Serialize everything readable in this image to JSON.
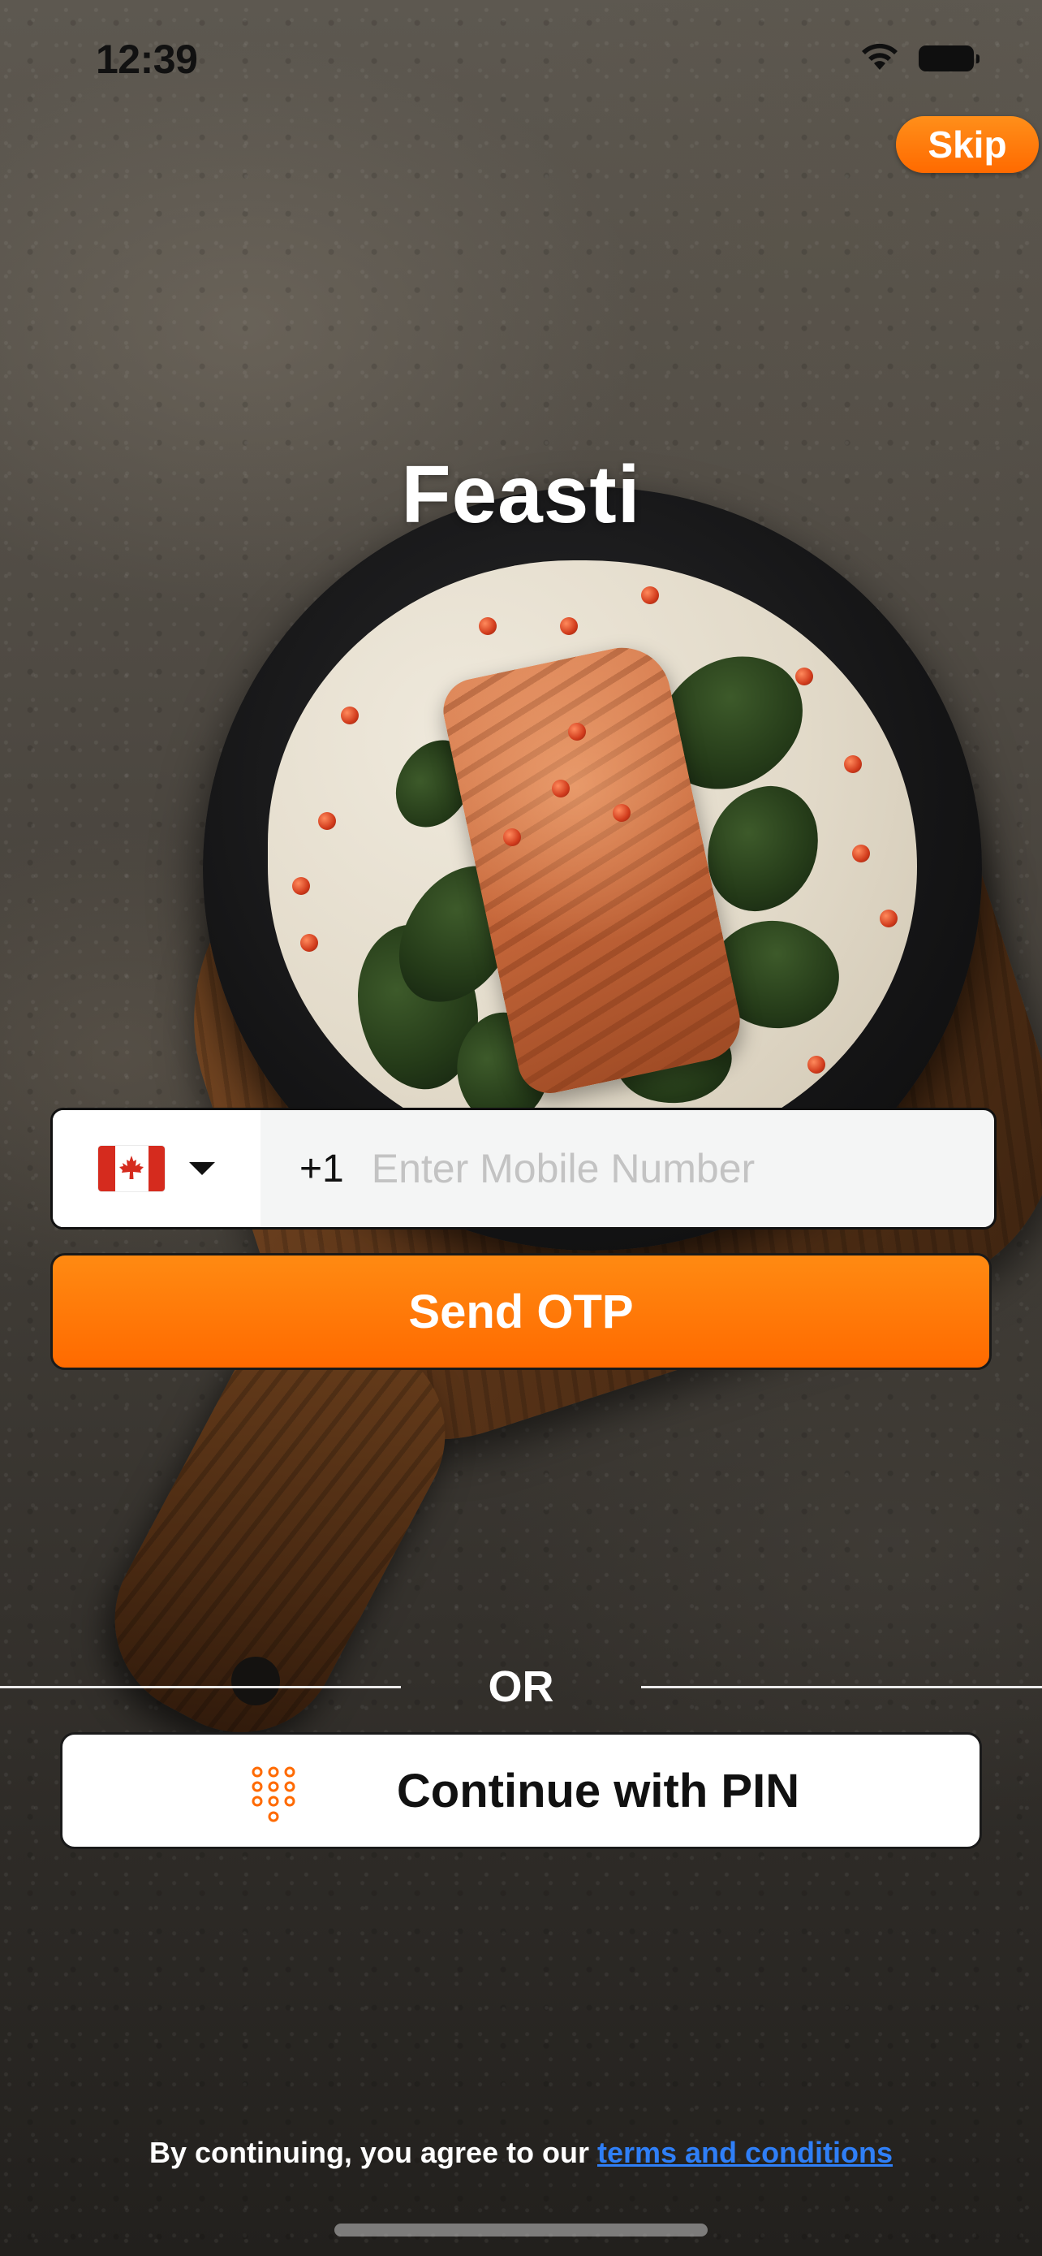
{
  "status_bar": {
    "time": "12:39",
    "icons": [
      "wifi-icon",
      "battery-icon"
    ]
  },
  "header": {
    "skip_label": "Skip"
  },
  "brand": {
    "title": "Feasti"
  },
  "login": {
    "country_flag": "canada-flag-icon",
    "dial_code": "+1",
    "mobile_placeholder": "Enter Mobile Number",
    "mobile_value": "",
    "send_otp_label": "Send OTP",
    "divider_label": "OR",
    "pin_label": "Continue with PIN",
    "pin_icon": "keypad-icon"
  },
  "footer": {
    "terms_prefix": "By continuing, you agree to our ",
    "terms_link": "terms and conditions"
  },
  "colors": {
    "accent": "#ff7300",
    "link": "#2f7ff7",
    "text_dark": "#111111"
  }
}
